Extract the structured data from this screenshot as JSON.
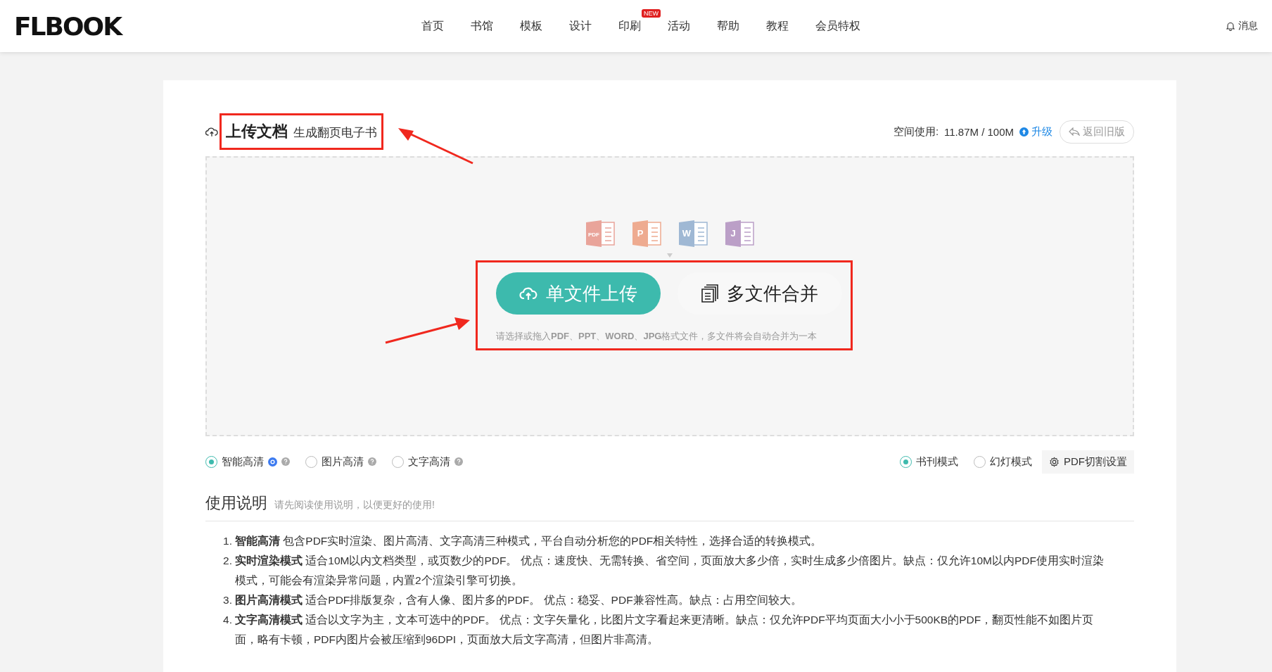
{
  "header": {
    "logo": "FLBOOK",
    "nav": [
      {
        "label": "首页"
      },
      {
        "label": "书馆"
      },
      {
        "label": "模板"
      },
      {
        "label": "设计"
      },
      {
        "label": "印刷",
        "badge": "NEW"
      },
      {
        "label": "活动"
      },
      {
        "label": "帮助"
      },
      {
        "label": "教程"
      },
      {
        "label": "会员特权"
      }
    ],
    "messages": "消息"
  },
  "upload": {
    "title": "上传文档",
    "subtitle": "生成翻页电子书",
    "usage_label": "空间使用:",
    "usage": "11.87M / 100M",
    "upgrade": "升级",
    "back": "返回旧版",
    "file_types": [
      {
        "letter": "PDF",
        "color": "#e9a49a"
      },
      {
        "letter": "P",
        "color": "#eeab90"
      },
      {
        "letter": "W",
        "color": "#9fb8d4"
      },
      {
        "letter": "J",
        "color": "#bb9fc7"
      }
    ],
    "single_button": "单文件上传",
    "multi_button": "多文件合并",
    "hint": "请选择或拖入**PDF**、**PPT**、**WORD**、**JPG**格式文件，多文件将会自动合并为一本"
  },
  "quality_options": [
    {
      "label": "智能高清",
      "selected": true,
      "badge": true
    },
    {
      "label": "图片高清",
      "selected": false,
      "badge": false
    },
    {
      "label": "文字高清",
      "selected": false,
      "badge": false
    }
  ],
  "mode_options": [
    {
      "label": "书刊模式",
      "selected": true
    },
    {
      "label": "幻灯模式",
      "selected": false
    }
  ],
  "split_button": "PDF切割设置",
  "instructions": {
    "title": "使用说明",
    "subtitle": "请先阅读使用说明，以便更好的使用!",
    "items": [
      {
        "marker": "1.",
        "text": "**智能高清** 包含PDF实时渲染、图片高清、文字高清三种模式，平台自动分析您的PDF相关特性，选择合适的转换模式。"
      },
      {
        "marker": "2.",
        "text": "**实时渲染模式** 适合10M以内文档类型，或页数少的PDF。 优点：速度快、无需转换、省空间，页面放大多少倍，实时生成多少倍图片。缺点：仅允许10M以内PDF使用实时渲染模式，可能会有渲染异常问题，内置2个渲染引擎可切换。"
      },
      {
        "marker": "3.",
        "text": "**图片高清模式** 适合PDF排版复杂，含有人像、图片多的PDF。 优点：稳妥、PDF兼容性高。缺点：占用空间较大。"
      },
      {
        "marker": "4.",
        "text": "**文字高清模式** 适合以文字为主，文本可选中的PDF。 优点：文字矢量化，比图片文字看起来更清晰。缺点：仅允许PDF平均页面大小小于500KB的PDF，翻页性能不如图片页面，略有卡顿，PDF内图片会被压缩到96DPI，页面放大后文字高清，但图片非高清。"
      }
    ]
  }
}
